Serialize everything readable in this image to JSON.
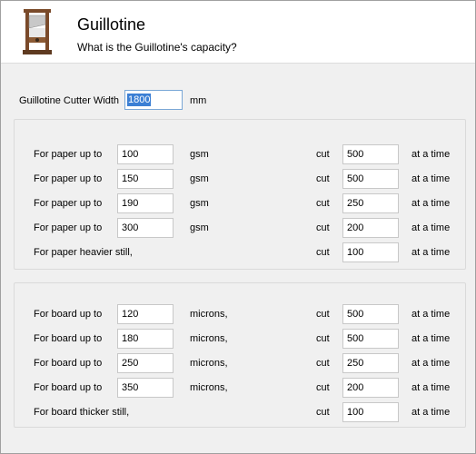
{
  "header": {
    "title": "Guillotine",
    "subtitle": "What is the Guillotine's capacity?",
    "logo_icon": "guillotine-icon"
  },
  "cutter_width": {
    "label": "Guillotine Cutter Width",
    "value": "1800",
    "unit": "mm"
  },
  "paper": {
    "rows": [
      {
        "prefix": "For paper up to",
        "weight": "100",
        "unit": "gsm",
        "cut_label": "cut",
        "cut": "500",
        "suffix": "at a time"
      },
      {
        "prefix": "For paper up to",
        "weight": "150",
        "unit": "gsm",
        "cut_label": "cut",
        "cut": "500",
        "suffix": "at a time"
      },
      {
        "prefix": "For paper up to",
        "weight": "190",
        "unit": "gsm",
        "cut_label": "cut",
        "cut": "250",
        "suffix": "at a time"
      },
      {
        "prefix": "For paper up to",
        "weight": "300",
        "unit": "gsm",
        "cut_label": "cut",
        "cut": "200",
        "suffix": "at a time"
      }
    ],
    "heavier": {
      "label": "For paper heavier still,",
      "cut_label": "cut",
      "cut": "100",
      "suffix": "at a time"
    }
  },
  "board": {
    "rows": [
      {
        "prefix": "For board up to",
        "thickness": "120",
        "unit": "microns,",
        "cut_label": "cut",
        "cut": "500",
        "suffix": "at a time"
      },
      {
        "prefix": "For board up to",
        "thickness": "180",
        "unit": "microns,",
        "cut_label": "cut",
        "cut": "500",
        "suffix": "at a time"
      },
      {
        "prefix": "For board up to",
        "thickness": "250",
        "unit": "microns,",
        "cut_label": "cut",
        "cut": "250",
        "suffix": "at a time"
      },
      {
        "prefix": "For board up to",
        "thickness": "350",
        "unit": "microns,",
        "cut_label": "cut",
        "cut": "200",
        "suffix": "at a time"
      }
    ],
    "thicker": {
      "label": "For board thicker still,",
      "cut_label": "cut",
      "cut": "100",
      "suffix": "at a time"
    }
  },
  "colors": {
    "selection": "#3b7fd4",
    "header_bg": "#ffffff",
    "panel_bg": "#f0f0f0"
  }
}
